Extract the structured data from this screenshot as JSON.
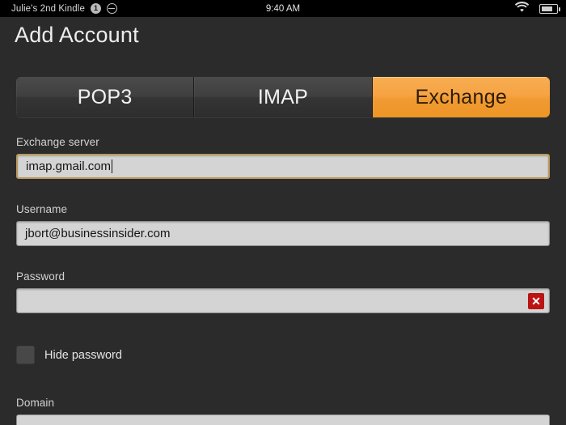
{
  "status_bar": {
    "device_name": "Julie's 2nd Kindle",
    "notification_count": "1",
    "dnd_icon": "do-not-disturb-icon",
    "clock": "9:40 AM",
    "wifi_icon": "wifi-icon",
    "battery_icon": "battery-icon"
  },
  "header": {
    "title": "Add Account"
  },
  "tabs": [
    {
      "label": "POP3",
      "active": false
    },
    {
      "label": "IMAP",
      "active": false
    },
    {
      "label": "Exchange",
      "active": true
    }
  ],
  "form": {
    "server": {
      "label": "Exchange server",
      "value": "imap.gmail.com",
      "placeholder": "",
      "focused": true
    },
    "username": {
      "label": "Username",
      "value": "jbort@businessinsider.com",
      "placeholder": "",
      "focused": false
    },
    "password": {
      "label": "Password",
      "value": "",
      "placeholder": "",
      "focused": false,
      "clear_icon": "clear-error-icon",
      "clear_glyph": "✕"
    },
    "hide_password": {
      "label": "Hide password",
      "checked": false
    },
    "domain": {
      "label": "Domain",
      "value": "",
      "placeholder": ""
    }
  },
  "colors": {
    "accent_orange": "#f0a03a",
    "background": "#2b2b2b",
    "status_bar": "#000000",
    "input_fill": "#d4d4d4",
    "focus_border": "#b99a5b",
    "error_red": "#bb1414"
  }
}
